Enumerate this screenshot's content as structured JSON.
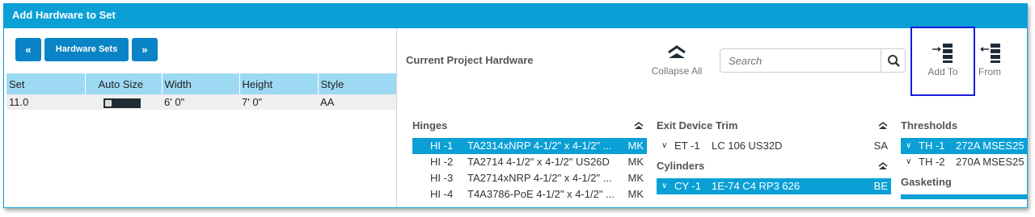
{
  "window": {
    "title": "Add Hardware to Set"
  },
  "nav": {
    "prev": "«",
    "sets": "Hardware Sets",
    "next": "»"
  },
  "sets_table": {
    "headers": [
      "Set",
      "Auto Size",
      "Width",
      "Height",
      "Style"
    ],
    "rows": [
      {
        "set": "11.0",
        "width": "6' 0\"",
        "height": "7' 0\"",
        "style": "AA"
      }
    ]
  },
  "project": {
    "title": "Current Project Hardware",
    "collapse_all": "Collapse All",
    "search_placeholder": "Search",
    "add_to": "Add To",
    "from": "From"
  },
  "groups": {
    "hinges": {
      "title": "Hinges",
      "rows": [
        {
          "code": "HI -1",
          "desc": "TA2314xNRP 4-1/2\" x 4-1/2\" ...",
          "mfr": "MK"
        },
        {
          "code": "HI -2",
          "desc": "TA2714 4-1/2\" x 4-1/2\" US26D",
          "mfr": "MK"
        },
        {
          "code": "HI -3",
          "desc": "TA2714xNRP 4-1/2\" x 4-1/2\" ...",
          "mfr": "MK"
        },
        {
          "code": "HI -4",
          "desc": "T4A3786-PoE 4-1/2\" x 4-1/2\" ...",
          "mfr": "MK"
        }
      ]
    },
    "exit_device_trim": {
      "title": "Exit Device Trim",
      "rows": [
        {
          "code": "ET -1",
          "desc": "LC 106 US32D",
          "mfr": "SA"
        }
      ]
    },
    "cylinders": {
      "title": "Cylinders",
      "rows": [
        {
          "code": "CY -1",
          "desc": "1E-74 C4 RP3 626",
          "mfr": "BE"
        }
      ]
    },
    "thresholds": {
      "title": "Thresholds",
      "rows": [
        {
          "code": "TH -1",
          "desc": "272A MSES25"
        },
        {
          "code": "TH -2",
          "desc": "270A MSES25"
        }
      ]
    },
    "gasketing": {
      "title": "Gasketing"
    }
  },
  "colors": {
    "titlebar": "#0aa0d6",
    "button": "#0a84c6",
    "header": "#9ed9f3",
    "selection": "#0aa0d6",
    "focus": "#1a1adb"
  }
}
